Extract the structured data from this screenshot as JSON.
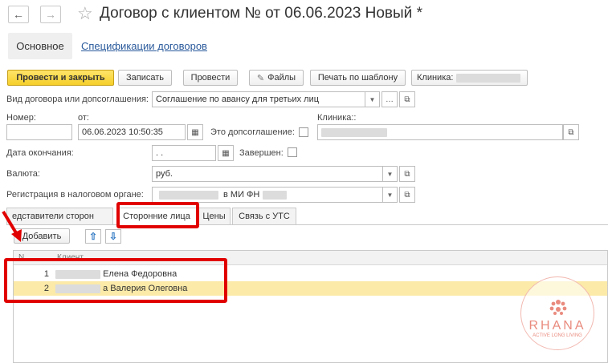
{
  "header": {
    "back_icon": "arrow-left-icon",
    "forward_icon": "arrow-right-icon",
    "star_icon": "star-icon",
    "title": "Договор с клиентом №  от 06.06.2023 Новый *"
  },
  "tabs_top": {
    "main": "Основное",
    "specs": "Спецификации договоров"
  },
  "toolbar": {
    "post_close": "Провести и закрыть",
    "save": "Записать",
    "post": "Провести",
    "files": "Файлы",
    "print_template": "Печать по шаблону",
    "clinic": "Клиника:"
  },
  "form": {
    "contract_type_label": "Вид договора или допсоглашения:",
    "contract_type_value": "Соглашение по авансу для третьих лиц",
    "number_label": "Номер:",
    "from_label": "от:",
    "date_value": "06.06.2023 10:50:35",
    "is_addendum_label": "Это допсоглашение:",
    "clinic_label": "Клиника::",
    "end_date_label": "Дата окончания:",
    "end_date_value": " .  .",
    "completed_label": "Завершен:",
    "currency_label": "Валюта:",
    "currency_value": "руб.",
    "tax_label": "Регистрация в налоговом органе:",
    "tax_value": "в МИ ФН"
  },
  "subtabs": {
    "reps": "едставители сторон",
    "third_parties": "Сторонние лица",
    "prices": "Цены",
    "uts": "Связь с УТС"
  },
  "table": {
    "add_button": "Добавить",
    "col_n": "N",
    "col_client": "Клиент",
    "rows": [
      {
        "n": "1",
        "client": "Елена Федоровна"
      },
      {
        "n": "2",
        "client": "а Валерия Олеговна"
      }
    ]
  },
  "watermark": {
    "brand": "RHANA",
    "tagline": "ACTIVE LONG LIVING"
  },
  "colors": {
    "primary_button": "#f5cf2a",
    "highlight": "#e10000",
    "selected_row": "#fbeaa8"
  }
}
